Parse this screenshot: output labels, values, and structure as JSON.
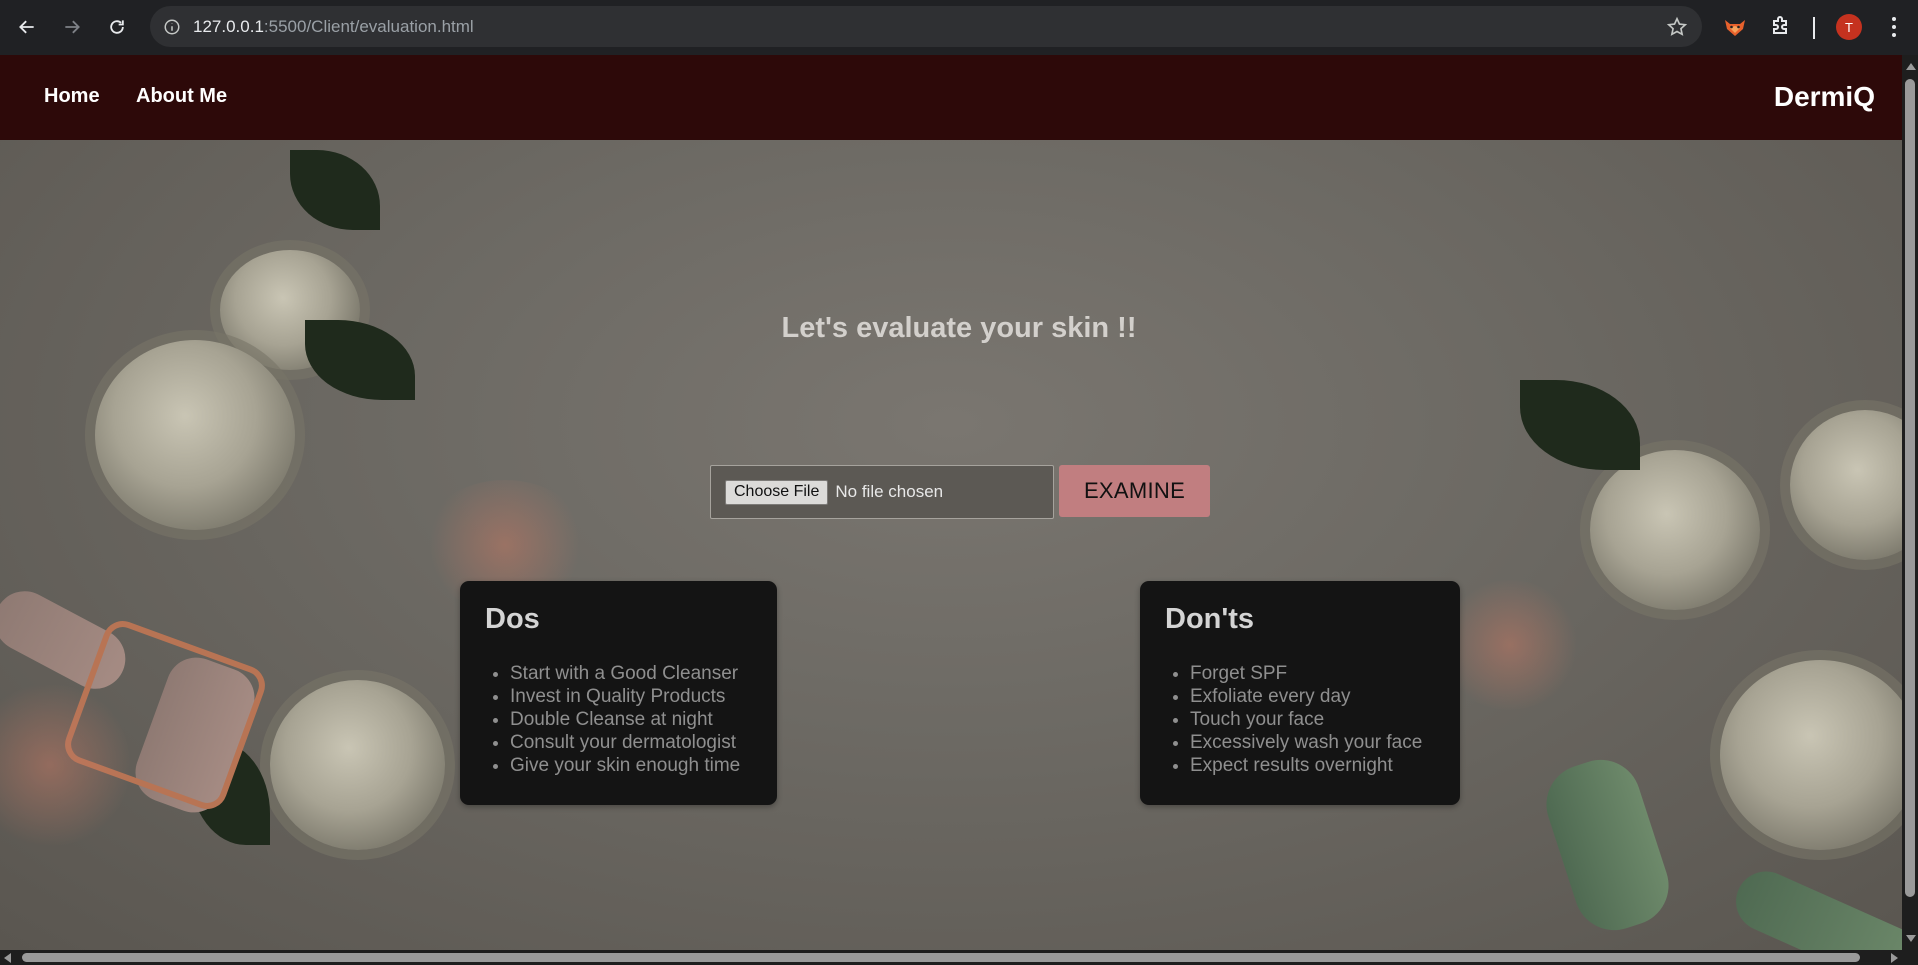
{
  "browser": {
    "url_host": "127.0.0.1",
    "url_path": ":5500/Client/evaluation.html",
    "avatar_initial": "T",
    "icons": {
      "back": "arrow-left-icon",
      "forward": "arrow-right-icon",
      "reload": "reload-icon",
      "site_info": "info-icon",
      "bookmark": "star-icon",
      "extension": "fox-extension-icon",
      "extensions_menu": "puzzle-icon",
      "menu": "kebab-menu-icon"
    }
  },
  "navbar": {
    "links": [
      {
        "label": "Home"
      },
      {
        "label": "About Me"
      }
    ],
    "brand": "DermiQ",
    "background": "#2d0909"
  },
  "main": {
    "heading": "Let's evaluate your skin !!",
    "file_input": {
      "button_label": "Choose File",
      "status": "No file chosen"
    },
    "examine_button": "EXAMINE",
    "accent": "#c17e80"
  },
  "cards": {
    "dos": {
      "title": "Dos",
      "items": [
        "Start with a Good Cleanser",
        "Invest in Quality Products",
        "Double Cleanse at night",
        "Consult your dermatologist",
        "Give your skin enough time"
      ]
    },
    "donts": {
      "title": "Don'ts",
      "items": [
        "Forget SPF",
        "Exfoliate every day",
        "Touch your face",
        "Excessively wash your face",
        "Expect results overnight"
      ]
    }
  }
}
